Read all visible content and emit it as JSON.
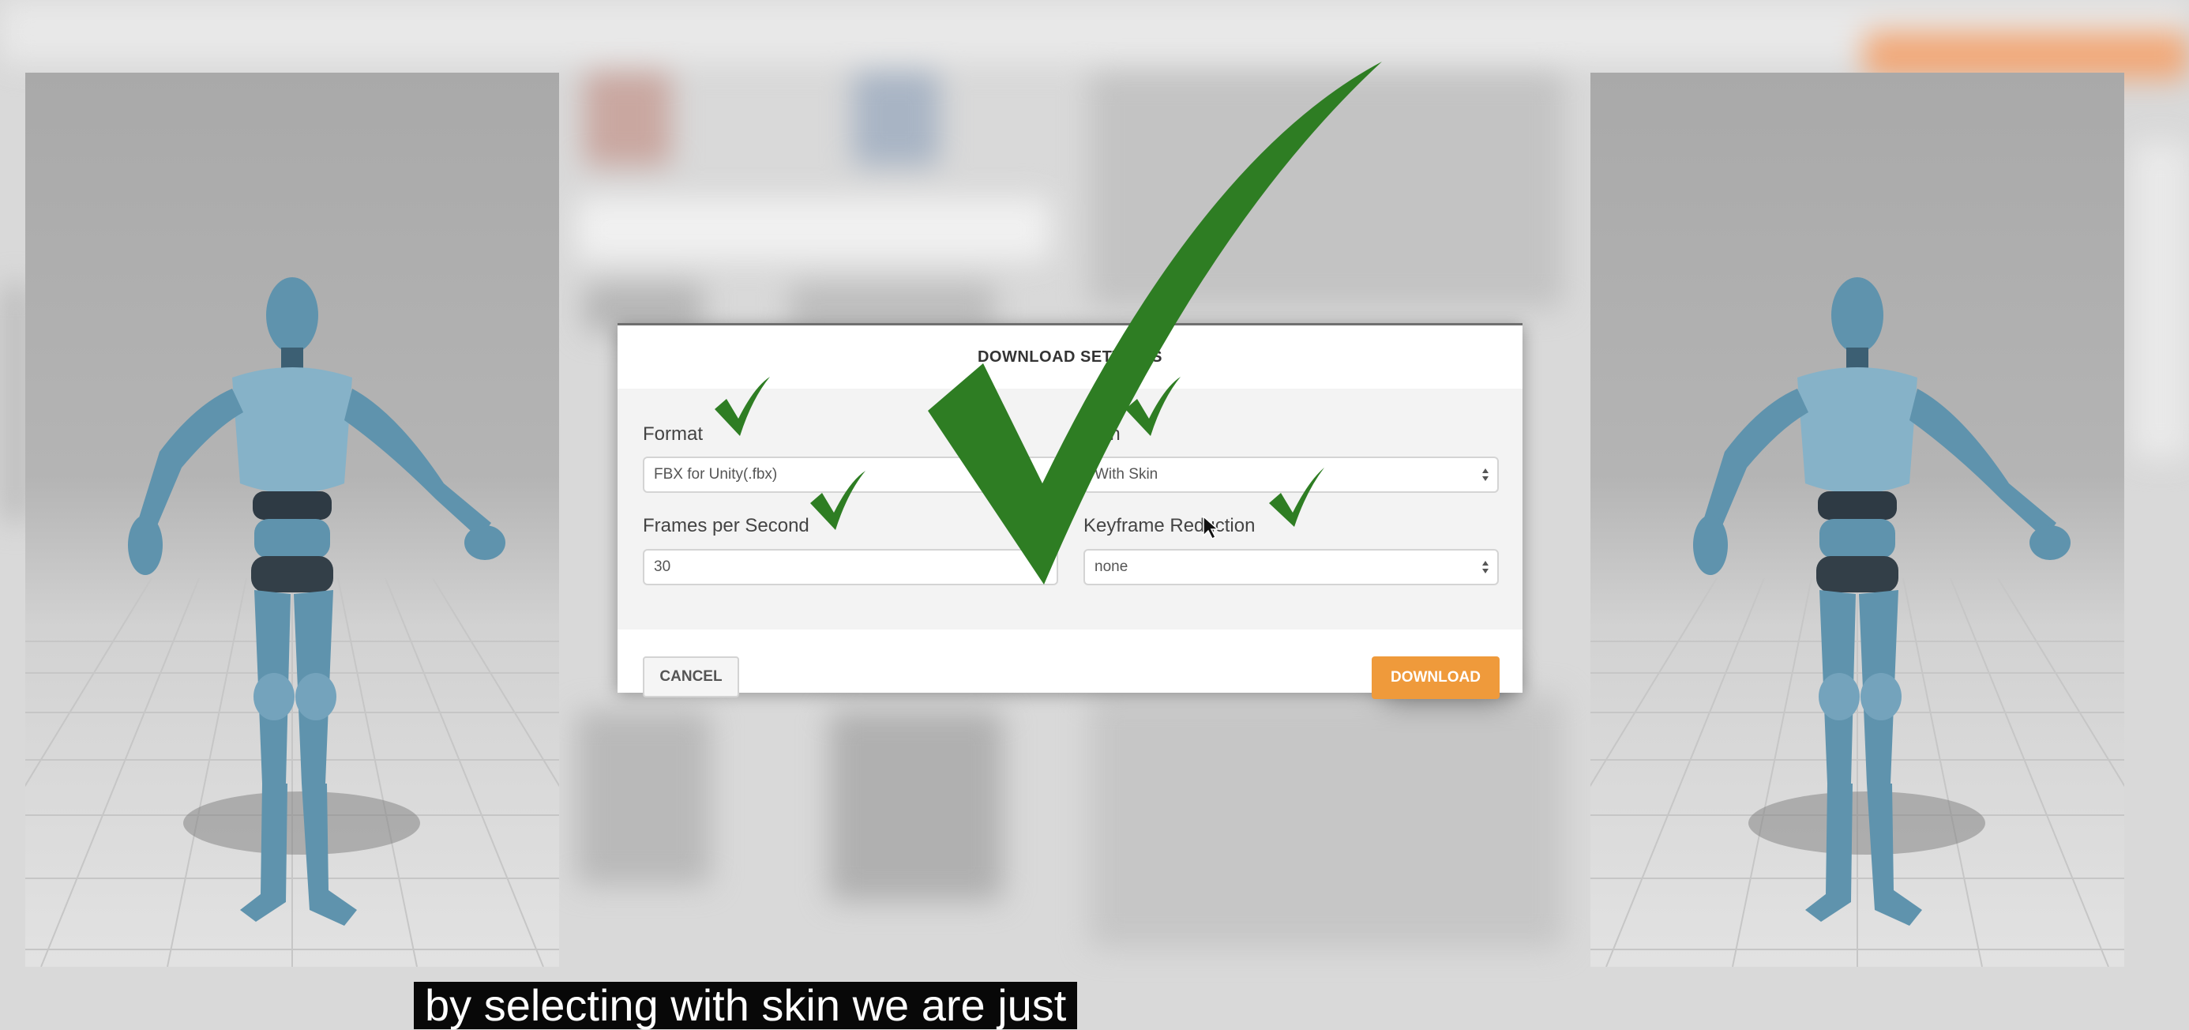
{
  "dialog": {
    "title": "DOWNLOAD SETTINGS",
    "format_label": "Format",
    "format_value": "FBX for Unity(.fbx)",
    "skin_label": "Skin",
    "skin_value": "With Skin",
    "fps_label": "Frames per Second",
    "fps_value": "30",
    "keyframe_label": "Keyframe Reduction",
    "keyframe_value": "none",
    "cancel_label": "CANCEL",
    "download_label": "DOWNLOAD"
  },
  "caption": {
    "text": "by selecting with skin we are just"
  },
  "colors": {
    "checkmark": "#2e7d23",
    "download_button": "#ef9a3b",
    "character": "#5f93ad"
  },
  "icons": [
    "checkmark-icon",
    "mouse-cursor-icon",
    "select-arrows-icon"
  ]
}
